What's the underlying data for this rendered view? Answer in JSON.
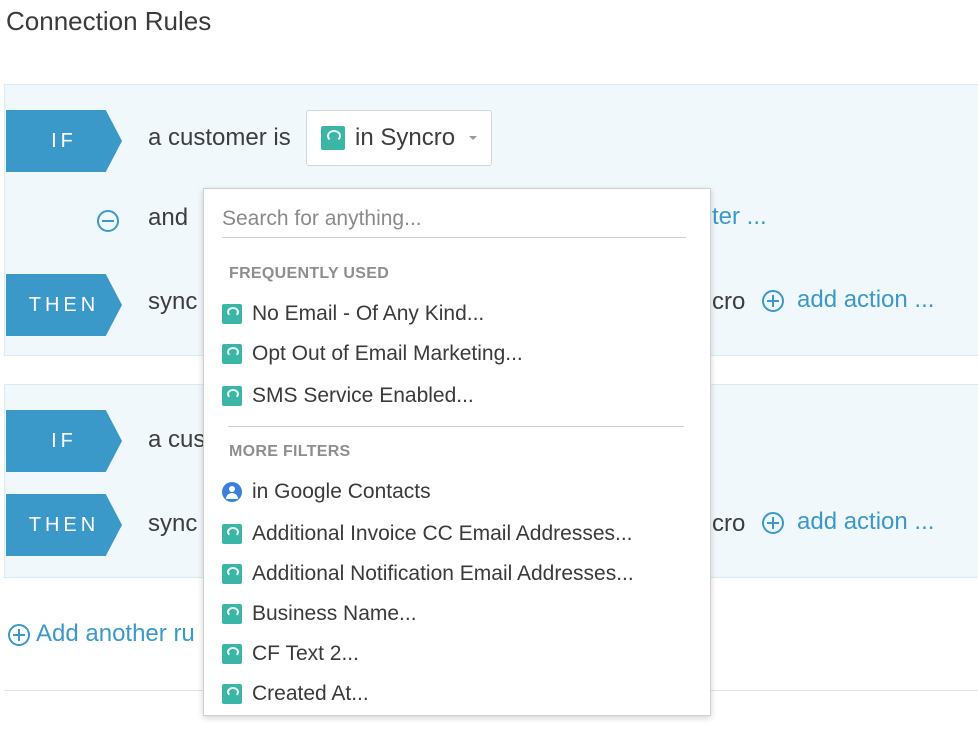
{
  "page": {
    "title": "Connection Rules"
  },
  "rule1": {
    "if_tag": "IF",
    "if_text": "a customer is",
    "selected_filter": "in Syncro",
    "and_text": "and",
    "add_filter_text": "ter ...",
    "then_tag": "THEN",
    "then_text": "sync",
    "then_tail": "cro",
    "add_action": "add action ..."
  },
  "rule2": {
    "if_tag": "IF",
    "if_text": "a cus",
    "then_tag": "THEN",
    "then_text": "sync",
    "then_tail": "cro",
    "add_action": "add action ..."
  },
  "add_another_rule": "Add another ru",
  "dropdown": {
    "search_placeholder": "Search for anything...",
    "frequently_used_label": "FREQUENTLY USED",
    "frequently_used": [
      {
        "label": "No Email - Of Any Kind...",
        "icon": "syncro-icon"
      },
      {
        "label": "Opt Out of Email Marketing...",
        "icon": "syncro-icon"
      },
      {
        "label": "SMS Service Enabled...",
        "icon": "syncro-icon"
      }
    ],
    "more_filters_label": "MORE FILTERS",
    "more_filters": [
      {
        "label": "in Google Contacts",
        "icon": "google-contacts-icon"
      },
      {
        "label": "Additional Invoice CC Email Addresses...",
        "icon": "syncro-icon"
      },
      {
        "label": "Additional Notification Email Addresses...",
        "icon": "syncro-icon"
      },
      {
        "label": "Business Name...",
        "icon": "syncro-icon"
      },
      {
        "label": "CF Text 2...",
        "icon": "syncro-icon"
      },
      {
        "label": "Created At...",
        "icon": "syncro-icon"
      }
    ]
  },
  "colors": {
    "accent": "#3a99c9",
    "rule_bg": "#f1f8fc",
    "syncro": "#3bb5a6",
    "google": "#3b7fe0"
  }
}
